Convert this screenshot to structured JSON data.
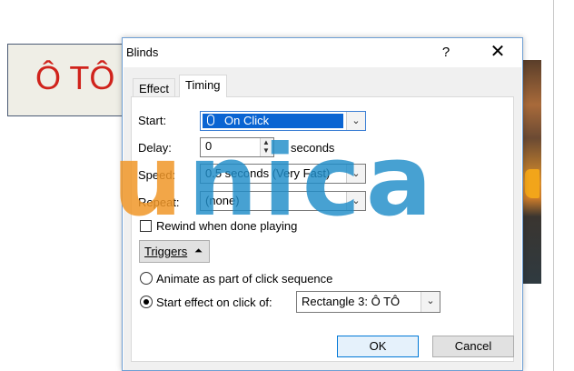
{
  "slide": {
    "shape_text": "Ô TÔ"
  },
  "dialog": {
    "title": "Blinds",
    "help_label": "?",
    "close_label": "✕",
    "tabs": [
      {
        "label": "Effect",
        "active": false
      },
      {
        "label": "Timing",
        "active": true
      }
    ],
    "start": {
      "label": "Start:",
      "value": "On Click"
    },
    "delay": {
      "label": "Delay:",
      "value": "0",
      "unit": "seconds"
    },
    "speed": {
      "label": "Speed:",
      "value": "0.5 seconds (Very Fast)"
    },
    "repeat": {
      "label": "Repeat:",
      "value": "(none)"
    },
    "rewind": {
      "label": "Rewind when done playing",
      "checked": false
    },
    "triggers_label": "Triggers",
    "animate_option": {
      "label": "Animate as part of click sequence",
      "selected": false
    },
    "start_effect_option": {
      "label": "Start effect on click of:",
      "selected": true
    },
    "trigger_target": "Rectangle 3: Ô TÔ",
    "ok_label": "OK",
    "cancel_label": "Cancel"
  },
  "watermark": {
    "text_part1": "u",
    "text_part2": "nica"
  },
  "colors": {
    "selection_blue": "#0a64d2",
    "dialog_border": "#6f9fd4",
    "shape_text_red": "#d0231c",
    "watermark_orange": "#f09628",
    "watermark_blue": "#1e8cc8"
  }
}
